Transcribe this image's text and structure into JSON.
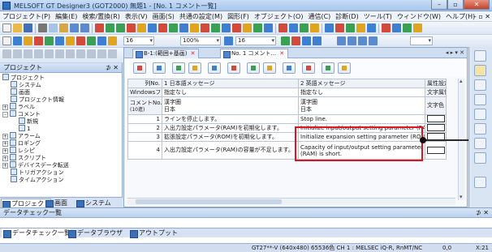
{
  "window": {
    "title": "MELSOFT GT Designer3 (GOT2000) 無題1 - [No. 1 コメント一覧]",
    "minimize": "–",
    "restore": "▫",
    "close": "✕"
  },
  "menu": {
    "items": [
      "プロジェクト(P)",
      "編集(E)",
      "検索/置換(R)",
      "表示(V)",
      "画面(S)",
      "共通の設定(M)",
      "図形(F)",
      "オブジェクト(O)",
      "通信(C)",
      "診断(D)",
      "ツール(T)",
      "ウィンドウ(W)",
      "ヘルプ(H)"
    ],
    "mdi_controls": "– ▫ ✕"
  },
  "toolbar": {
    "font_size": "16",
    "zoom": "100%",
    "grid_size": "16"
  },
  "project_pane": {
    "title": "プロジェクト",
    "pin": "⊅ ✕",
    "tree": [
      {
        "label": "プロジェクト",
        "level": 0,
        "expander": ""
      },
      {
        "label": "システム",
        "level": 1,
        "expander": ""
      },
      {
        "label": "画面",
        "level": 1,
        "expander": ""
      },
      {
        "label": "プロジェクト情報",
        "level": 1,
        "expander": ""
      },
      {
        "label": "ラベル",
        "level": 0,
        "expander": "+"
      },
      {
        "label": "コメント",
        "level": 0,
        "expander": "–"
      },
      {
        "label": "新規",
        "level": 1,
        "expander": ""
      },
      {
        "label": "1",
        "level": 1,
        "expander": ""
      },
      {
        "label": "アラーム",
        "level": 0,
        "expander": "+"
      },
      {
        "label": "ロギング",
        "level": 0,
        "expander": "+"
      },
      {
        "label": "レシピ",
        "level": 0,
        "expander": "+"
      },
      {
        "label": "スクリプト",
        "level": 0,
        "expander": "+"
      },
      {
        "label": "デバイスデータ転送",
        "level": 0,
        "expander": "+"
      },
      {
        "label": "トリガアクション",
        "level": 0,
        "expander": ""
      },
      {
        "label": "タイムアクション",
        "level": 0,
        "expander": ""
      }
    ],
    "tabs": [
      "プロジェクト",
      "画面",
      "システム"
    ]
  },
  "editor": {
    "tabs": [
      {
        "label": "B-1:(範囲+基画)",
        "active": false
      },
      {
        "label": "No. 1 コメント...",
        "active": true
      }
    ],
    "tab_close": "✕",
    "tab_scroll": "◂ ▸ ▾ ✕",
    "grid": {
      "header": {
        "col_no": "列No.",
        "col1": "1 日本語メッセージ",
        "col2": "2 英語メッセージ",
        "attr": "属性設定"
      },
      "font_row": {
        "label": "Windowsフォント",
        "col1": "指定なし",
        "col2": "指定なし",
        "attr": "文字属性"
      },
      "comment_row": {
        "label": "コメントNo.",
        "sublabel": "(10進)",
        "col1": "漢字圏",
        "col1_sub": "日本",
        "col2": "漢字圏",
        "col2_sub": "日本",
        "attr": "文字色"
      },
      "rows": [
        {
          "no": "1",
          "jp": "ラインを停止します。",
          "en": "Stop line."
        },
        {
          "no": "2",
          "jp": "入出力設定パラメータ(RAM)を初期化します。",
          "en": "Initialize input/output setting parameter (RAM)."
        },
        {
          "no": "3",
          "jp": "拡張設定パラメータ(ROM)を初期化します。",
          "en": "Initialize expansion setting parameter (ROM)."
        },
        {
          "no": "4",
          "jp": "入出力設定パラメータ(RAM)の容量が不足します。",
          "en": "Capacity of input/output setting parameter (RAM) is short."
        }
      ]
    }
  },
  "datacheck_pane": {
    "title": "データチェック一覧",
    "pin": "⊅ ✕",
    "tabs": [
      "データチェック一覧",
      "データブラウザ",
      "アウトプット"
    ]
  },
  "status": {
    "text": "GT27**-V (640x480)  65536色  CH 1 : MELSEC iQ-R, RnMT/NC",
    "coord": "0,0",
    "xpos": "X:21"
  },
  "colors": {
    "callout": "#e0141e",
    "titlebar": "#a9c6ec"
  }
}
